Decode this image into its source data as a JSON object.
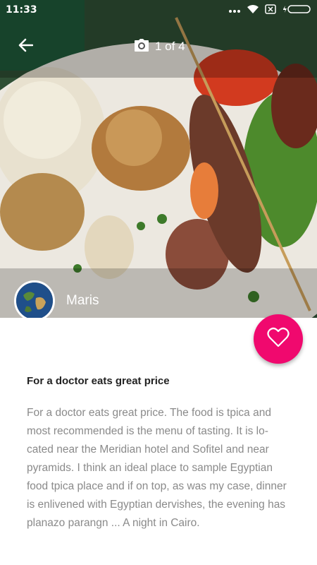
{
  "status_bar": {
    "time": "11:33",
    "icons": [
      "dots-icon",
      "wifi-icon",
      "sim-icon",
      "battery-icon"
    ]
  },
  "header": {
    "back_icon": "arrow-left-icon",
    "camera_icon": "camera-icon",
    "photo_counter": "1 of 4"
  },
  "author": {
    "name": "Maris",
    "avatar_icon": "globe-avatar"
  },
  "favorite": {
    "icon": "heart-outline-icon",
    "color": "#f0096e"
  },
  "review": {
    "title": "For a doctor eats great price",
    "body": "For a doctor eats great price. The food is tpica and most recommended is the menu of tasting. It is lo-cated near the Meridian hotel and Sofitel and near pyramids. I think an ideal place to sample Egyptian food tpica place and if on top, as was my case, dinner is enlivened with Egyptian dervishes, the evening has planazo parangn ... A night in Cairo."
  }
}
